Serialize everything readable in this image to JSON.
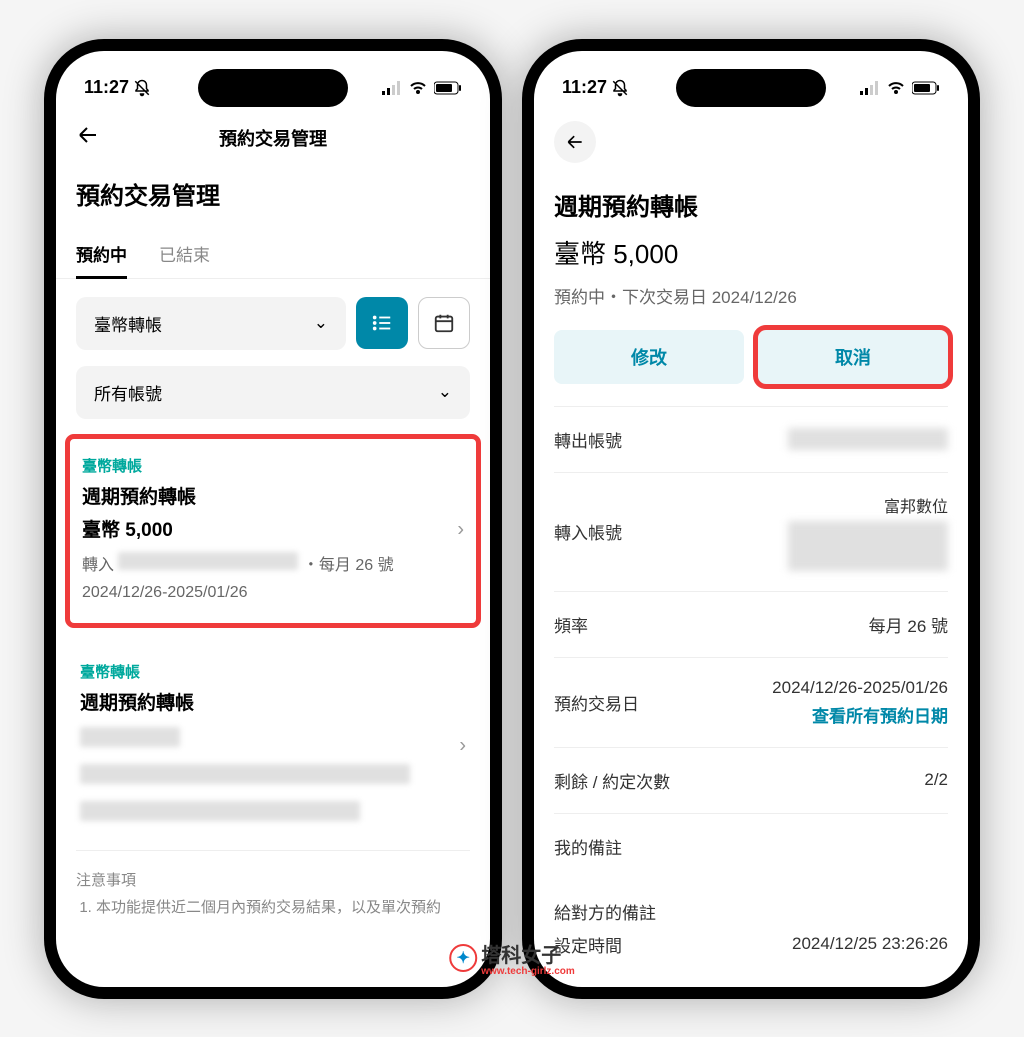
{
  "status": {
    "time": "11:27"
  },
  "left": {
    "nav_title": "預約交易管理",
    "page_title": "預約交易管理",
    "tabs": {
      "active": "預約中",
      "ended": "已結束"
    },
    "filter_type": "臺幣轉帳",
    "filter_account": "所有帳號",
    "card1": {
      "tag": "臺幣轉帳",
      "title": "週期預約轉帳",
      "amount": "臺幣 5,000",
      "meta1_prefix": "轉入",
      "meta1_suffix": "・每月 26 號",
      "meta2": "2024/12/26-2025/01/26"
    },
    "card2": {
      "tag": "臺幣轉帳",
      "title": "週期預約轉帳"
    },
    "notes_title": "注意事項",
    "note1": "本功能提供近二個月內預約交易結果，以及單次預約"
  },
  "right": {
    "title": "週期預約轉帳",
    "amount": "臺幣 5,000",
    "status": "預約中・下次交易日 2024/12/26",
    "modify": "修改",
    "cancel": "取消",
    "rows": {
      "out_account": "轉出帳號",
      "in_account": "轉入帳號",
      "in_bank": "富邦數位",
      "freq_label": "頻率",
      "freq_value": "每月 26 號",
      "date_label": "預約交易日",
      "date_value": "2024/12/26-2025/01/26",
      "date_link": "查看所有預約日期",
      "remain_label": "剩餘 / 約定次數",
      "remain_value": "2/2",
      "my_note": "我的備註",
      "their_note": "給對方的備註",
      "set_time_label": "設定時間",
      "set_time_partial": "2024/12/25 23:26:26"
    }
  },
  "watermark": {
    "text": "塔科女子",
    "url": "www.tech-girlz.com"
  }
}
